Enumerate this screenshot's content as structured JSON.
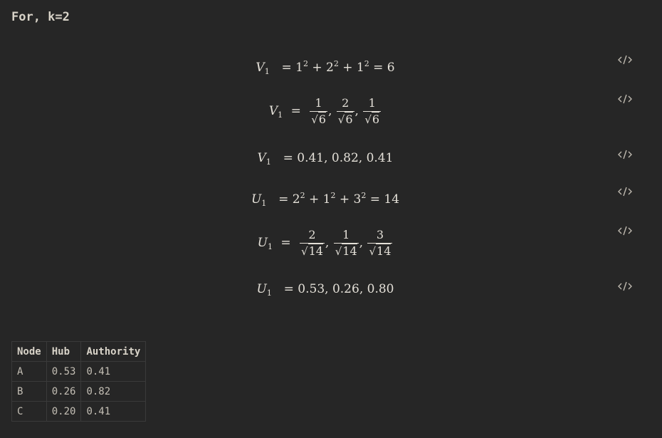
{
  "heading": "For, k=2",
  "equations": {
    "e1": {
      "lhs_var": "V",
      "lhs_sub": "1",
      "rest": [
        "= 1",
        "2",
        "+ 2",
        "2",
        "+ 1",
        "2",
        "= 6"
      ]
    },
    "e2": {
      "lhs_var": "V",
      "lhs_sub": "1",
      "eq": "=",
      "fractions": [
        {
          "num": "1",
          "den": "6"
        },
        {
          "num": "2",
          "den": "6"
        },
        {
          "num": "1",
          "den": "6"
        }
      ],
      "sep": ","
    },
    "e3": {
      "lhs_var": "V",
      "lhs_sub": "1",
      "rhs": "= 0.41, 0.82, 0.41"
    },
    "e4": {
      "lhs_var": "U",
      "lhs_sub": "1",
      "rest": [
        "= 2",
        "2",
        "+ 1",
        "2",
        "+ 3",
        "2",
        "= 14"
      ]
    },
    "e5": {
      "lhs_var": "U",
      "lhs_sub": "1",
      "eq": "=",
      "fractions": [
        {
          "num": "2",
          "den": "14"
        },
        {
          "num": "1",
          "den": "14"
        },
        {
          "num": "3",
          "den": "14"
        }
      ],
      "sep": ","
    },
    "e6": {
      "lhs_var": "U",
      "lhs_sub": "1",
      "rhs": "= 0.53, 0.26, 0.80"
    },
    "radical": "√"
  },
  "code_icon_name": "code-icon",
  "table": {
    "headers": [
      "Node",
      "Hub",
      "Authority"
    ],
    "rows": [
      [
        "A",
        "0.53",
        "0.41"
      ],
      [
        "B",
        "0.26",
        "0.82"
      ],
      [
        "C",
        "0.20",
        "0.41"
      ]
    ]
  }
}
